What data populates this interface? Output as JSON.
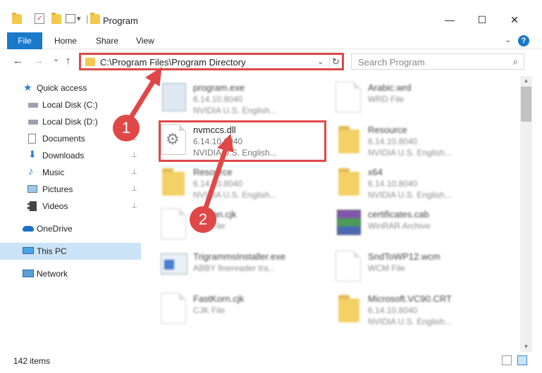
{
  "window": {
    "title": "Program",
    "minimize_glyph": "—",
    "maximize_glyph": "☐",
    "close_glyph": "✕",
    "qat_dropdown_glyph": "▾",
    "title_separator": "|"
  },
  "ribbon": {
    "tabs": [
      "File",
      "Home",
      "Share",
      "View"
    ],
    "help_glyph": "?",
    "expand_glyph": "⌄"
  },
  "nav": {
    "back_glyph": "←",
    "forward_glyph": "→",
    "recent_glyph": "⌄",
    "up_glyph": "↑",
    "address": "C:\\Program Files\\Program Directory",
    "address_dropdown_glyph": "⌄",
    "refresh_glyph": "↻",
    "search_placeholder": "Search Program",
    "search_glyph": "⌕"
  },
  "sidebar": {
    "items": [
      {
        "label": "Quick access",
        "icon": "star-icon",
        "pinned": false
      },
      {
        "label": "Local Disk (C:)",
        "icon": "drive-icon",
        "pinned": false
      },
      {
        "label": "Local Disk (D:)",
        "icon": "drive-icon",
        "pinned": false
      },
      {
        "label": "Documents",
        "icon": "documents-icon",
        "pinned": true
      },
      {
        "label": "Downloads",
        "icon": "download-icon",
        "pinned": true
      },
      {
        "label": "Music",
        "icon": "music-icon",
        "pinned": true
      },
      {
        "label": "Pictures",
        "icon": "pictures-icon",
        "pinned": true
      },
      {
        "label": "Videos",
        "icon": "videos-icon",
        "pinned": true
      },
      {
        "label": "OneDrive",
        "icon": "cloud-icon",
        "pinned": false
      },
      {
        "label": "This PC",
        "icon": "computer-icon",
        "pinned": false,
        "selected": true
      },
      {
        "label": "Network",
        "icon": "network-icon",
        "pinned": false
      }
    ],
    "pin_glyph": "📌"
  },
  "files": [
    {
      "name": "program.exe",
      "line1": "6.14.10.8040",
      "line2": "NVIDIA U.S. English...",
      "icon": "exe-icon"
    },
    {
      "name": "Arabic.wrd",
      "line1": "WRD File",
      "line2": "",
      "icon": "file-icon"
    },
    {
      "name": "nvmccs.dll",
      "line1": "6.14.10.8040",
      "line2": "NVIDIA U.S. English...",
      "icon": "dll-gear-icon",
      "highlighted": true
    },
    {
      "name": "Resource",
      "line1": "6.14.10.8040",
      "line2": "NVIDIA U.S. English...",
      "icon": "folder-icon"
    },
    {
      "name": "Resource",
      "line1": "6.14.10.8040",
      "line2": "NVIDIA U.S. English...",
      "icon": "folder-icon"
    },
    {
      "name": "x64",
      "line1": "6.14.10.8040",
      "line2": "NVIDIA U.S. English...",
      "icon": "folder-icon"
    },
    {
      "name": "Korean.cjk",
      "line1": "CJK File",
      "line2": "",
      "icon": "file-icon"
    },
    {
      "name": "certificates.cab",
      "line1": "WinRAR Archive",
      "line2": "",
      "icon": "winrar-icon"
    },
    {
      "name": "TrigrammsInstaller.exe",
      "line1": "ABBY finereader tra...",
      "line2": "",
      "icon": "exe-icon"
    },
    {
      "name": "SndToWP12.wcm",
      "line1": "WCM File",
      "line2": "",
      "icon": "file-icon"
    },
    {
      "name": "FastKorn.cjk",
      "line1": "CJK File",
      "line2": "",
      "icon": "file-icon"
    },
    {
      "name": "Microsoft.VC90.CRT",
      "line1": "6.14.10.8040",
      "line2": "NVIDIA U.S. English...",
      "icon": "folder-icon"
    }
  ],
  "status": {
    "items_count": "142 items"
  },
  "callouts": {
    "step1": "1",
    "step2": "2"
  },
  "colors": {
    "accent": "#1979ca",
    "highlight": "#e04848",
    "folder": "#f2c94c",
    "selected": "#cce4f7"
  }
}
